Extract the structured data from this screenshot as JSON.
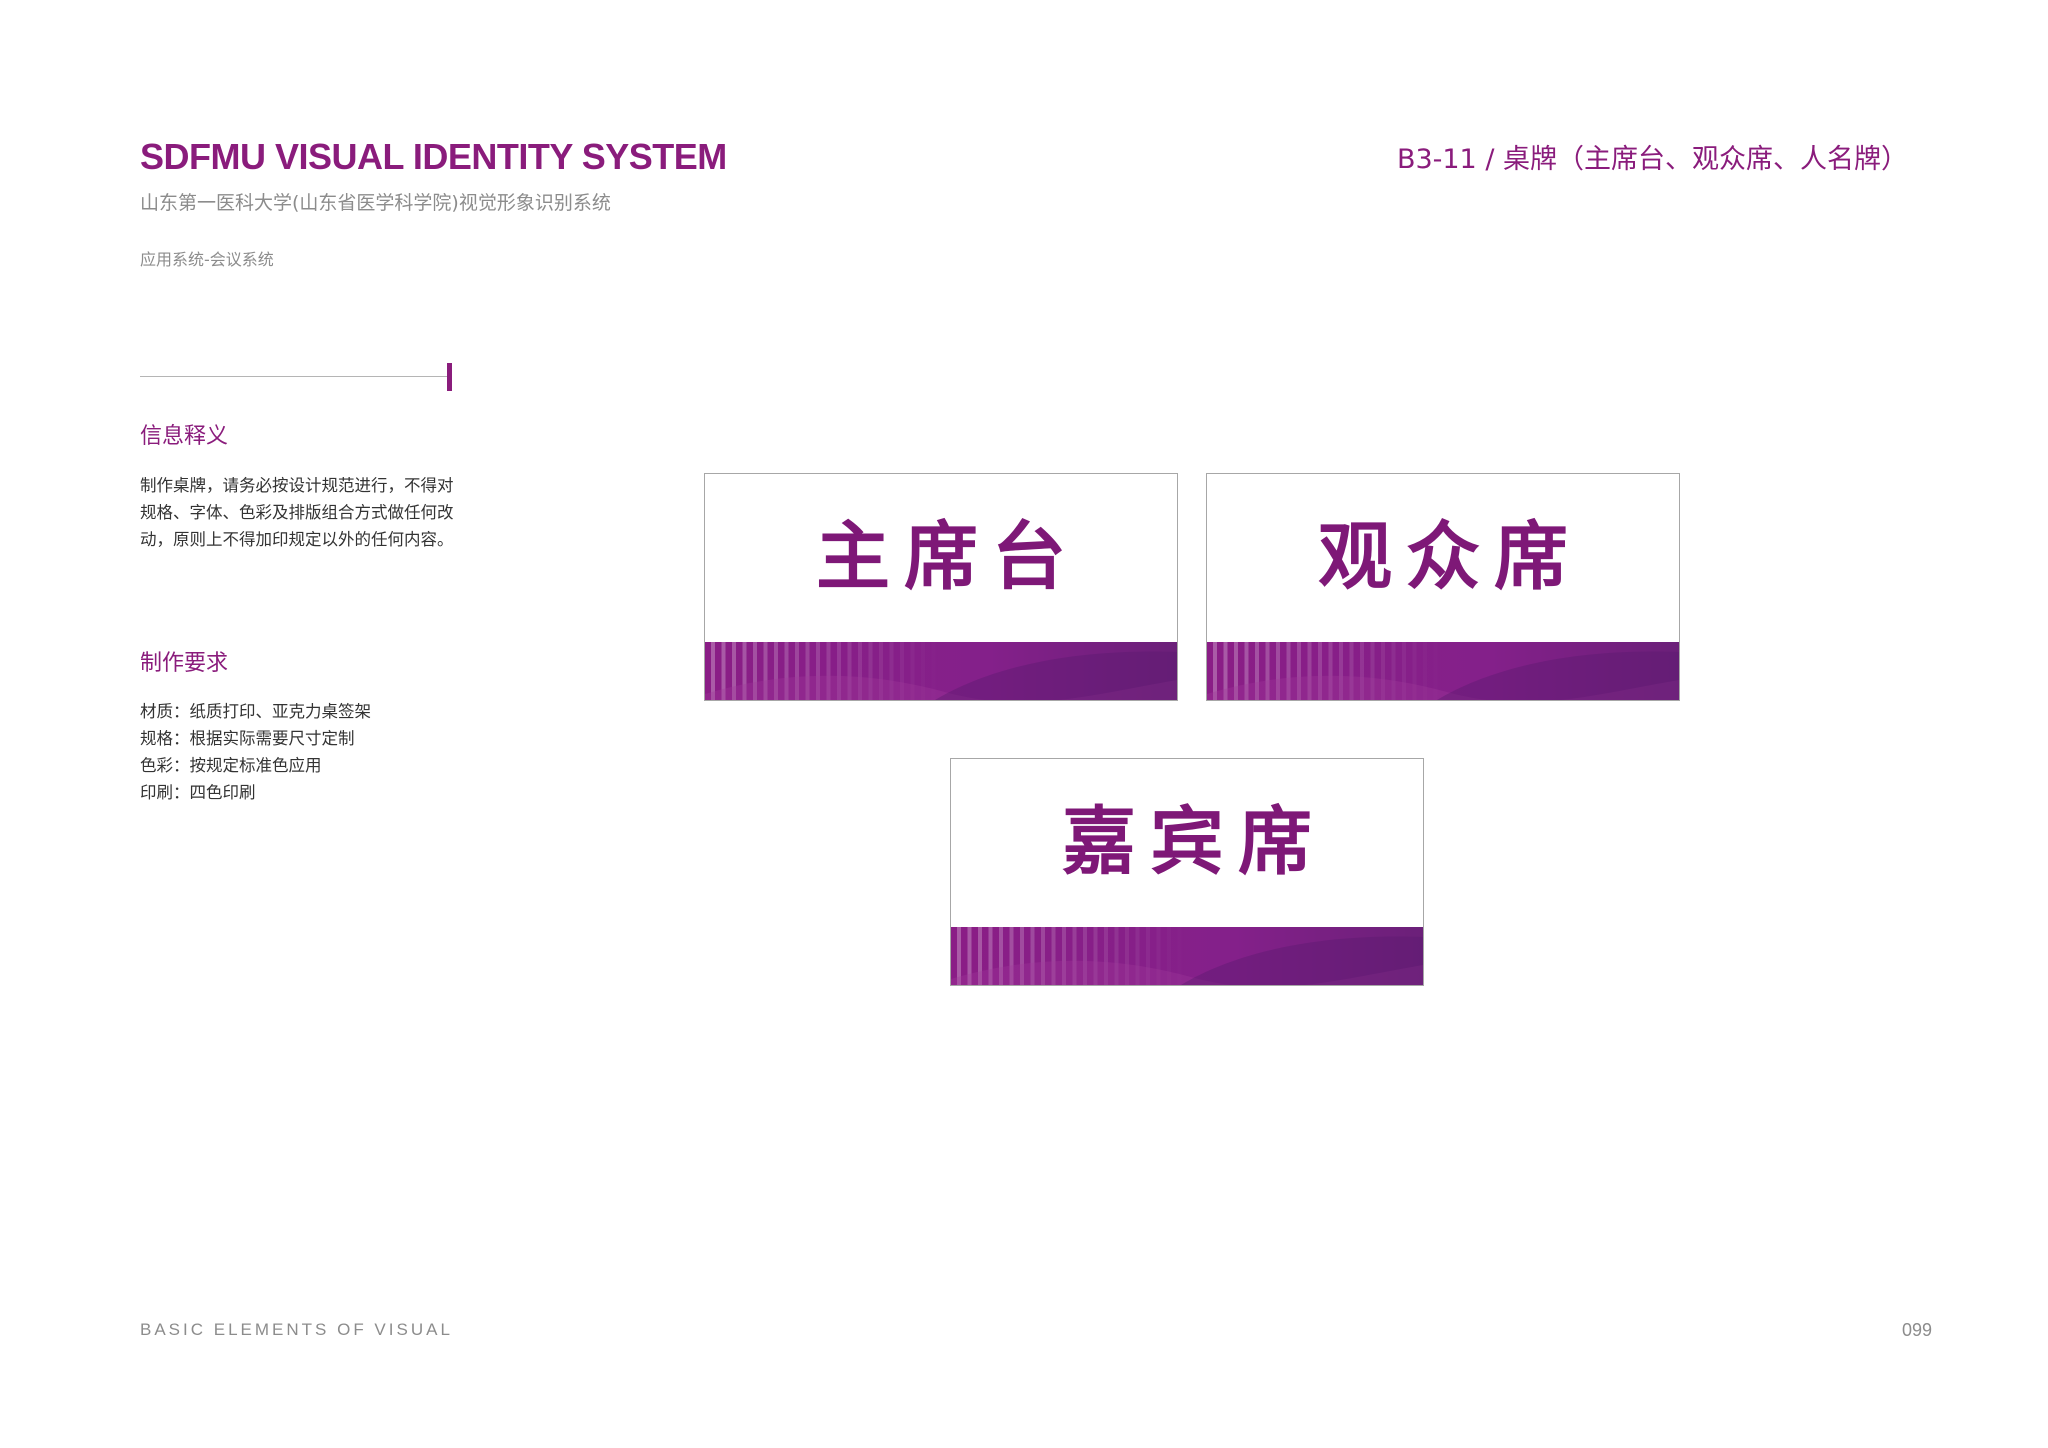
{
  "header": {
    "brand_title": "SDFMU VISUAL IDENTITY SYSTEM",
    "brand_subtitle": "山东第一医科大学(山东省医学科学院)视觉形象识别系统",
    "section_path": "应用系统-会议系统",
    "code_title": "B3-11 / 桌牌（主席台、观众席、人名牌）"
  },
  "sidebar": {
    "info_heading": "信息释义",
    "info_text": "制作桌牌，请务必按设计规范进行，不得对规格、字体、色彩及排版组合方式做任何改动，原则上不得加印规定以外的任何内容。",
    "requirements_heading": "制作要求",
    "requirements": [
      "材质：纸质打印、亚克力桌签架",
      "规格：根据实际需要尺寸定制",
      "色彩：按规定标准色应用",
      "印刷：四色印刷"
    ]
  },
  "signs": [
    {
      "label": "主席台"
    },
    {
      "label": "观众席"
    },
    {
      "label": "嘉宾席"
    }
  ],
  "footer": {
    "left_text": "BASIC ELEMENTS OF VISUAL",
    "page_number": "099"
  },
  "colors": {
    "brand_purple": "#8a1c7c",
    "band_purple": "#8a1d86",
    "band_dark": "#6b2079",
    "text_gray": "#8c8c8c",
    "body_text": "#333333"
  }
}
